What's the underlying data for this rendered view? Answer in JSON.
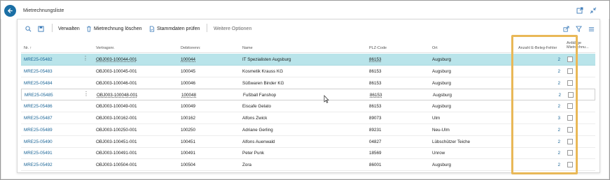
{
  "page": {
    "title": "Mietrechnungsliste"
  },
  "actions": {
    "verwalten": "Verwalten",
    "loeschen": "Mietrechnung löschen",
    "stammdaten": "Stammdaten prüfen",
    "weitere": "Weitere Optionen"
  },
  "columns": {
    "nr": "Nr. ↑",
    "vertragsnr": "Vertragsnr.",
    "debitorennr": "Debitorenn:",
    "name": "Name",
    "plz": "PLZ-Code",
    "ort": "Ort",
    "anzahl": "Anzahl E-Beleg-Fehler",
    "anfaellige_1": "Anfällige",
    "anfaellige_2": "Mietrechnu..."
  },
  "rows": [
    {
      "nr": "MRE25-05482",
      "vertragsnr": "OBJ003-100044-001",
      "debitorennr": "100044",
      "name": "IT Spezialisten Augsburg",
      "plz": "86153",
      "ort": "Augsburg",
      "anzahl": "2"
    },
    {
      "nr": "MRE25-05483",
      "vertragsnr": "OBJ003-100045-001",
      "debitorennr": "100045",
      "name": "Kosmetik Krauss KG",
      "plz": "86153",
      "ort": "Augsburg",
      "anzahl": "2"
    },
    {
      "nr": "MRE25-05484",
      "vertragsnr": "OBJ003-100046-001",
      "debitorennr": "100046",
      "name": "Süßwaren Binder KG",
      "plz": "86153",
      "ort": "Augsburg",
      "anzahl": "2"
    },
    {
      "nr": "MRE25-05485",
      "vertragsnr": "OBJ003-100048-001",
      "debitorennr": "100048",
      "name": "Fußball Fanshop",
      "plz": "86153",
      "ort": "Augsburg",
      "anzahl": "2"
    },
    {
      "nr": "MRE25-05486",
      "vertragsnr": "OBJ003-100049-001",
      "debitorennr": "100049",
      "name": "Eiscafe Gelato",
      "plz": "86153",
      "ort": "Augsburg",
      "anzahl": "2"
    },
    {
      "nr": "MRE25-05487",
      "vertragsnr": "OBJ003-100162-001",
      "debitorennr": "100162",
      "name": "Alfons Zwick",
      "plz": "89073",
      "ort": "Ulm",
      "anzahl": "3"
    },
    {
      "nr": "MRE25-05489",
      "vertragsnr": "OBJ003-100250-001",
      "debitorennr": "100250",
      "name": "Adriane Gerling",
      "plz": "89231",
      "ort": "Neu-Ulm",
      "anzahl": "2"
    },
    {
      "nr": "MRE25-05490",
      "vertragsnr": "OBJ003-100451-001",
      "debitorennr": "100451",
      "name": "Alfons Auenwald",
      "plz": "04827",
      "ort": "Lübschützer Teiche",
      "anzahl": "2"
    },
    {
      "nr": "MRE25-05491",
      "vertragsnr": "OBJ003-100491-001",
      "debitorennr": "100491",
      "name": "Peter Punk",
      "plz": "18569",
      "ort": "Unrow",
      "anzahl": "2"
    },
    {
      "nr": "MRE25-05492",
      "vertragsnr": "OBJ003-100504-001",
      "debitorennr": "100504",
      "name": "Zora",
      "plz": "86001",
      "ort": "Augsburg",
      "anzahl": "2"
    }
  ],
  "colors": {
    "accent": "#1b6fa5",
    "selected_row": "#b9e4ea",
    "highlight_frame": "#e9b857"
  }
}
